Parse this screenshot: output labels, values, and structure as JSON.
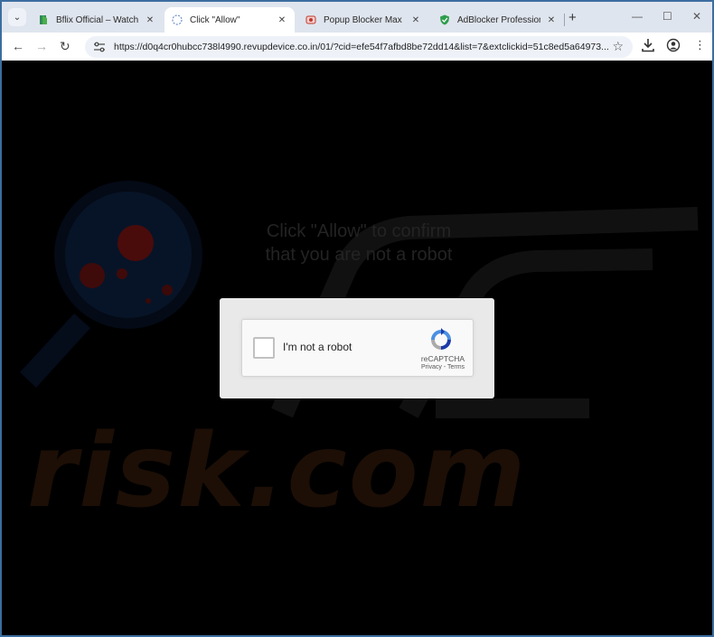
{
  "browser": {
    "tabs": [
      {
        "label": "Bflix Official – Watch Movies",
        "close": "✕"
      },
      {
        "label": "Click \"Allow\"",
        "close": "✕"
      },
      {
        "label": "Popup Blocker Max",
        "close": "✕"
      },
      {
        "label": "AdBlocker Professional",
        "close": "✕"
      }
    ],
    "new_tab": "+",
    "url": "https://d0q4cr0hubcc738l4990.revupdevice.co.in/01/?cid=efe54f7afbd8be72dd14&list=7&extclickid=51c8ed5a64973..."
  },
  "page": {
    "headline_line1": "Click \"Allow\" to confirm",
    "headline_line2": "that you are not a robot",
    "watermark": "risk.com"
  },
  "captcha": {
    "label": "I'm not a robot",
    "brand": "reCAPTCHA",
    "links": "Privacy - Terms"
  },
  "colors": {
    "tabstrip": "#dfe5ee",
    "watermark_orange": "#1d0f06",
    "magnifier_red": "#4a0b0b"
  }
}
